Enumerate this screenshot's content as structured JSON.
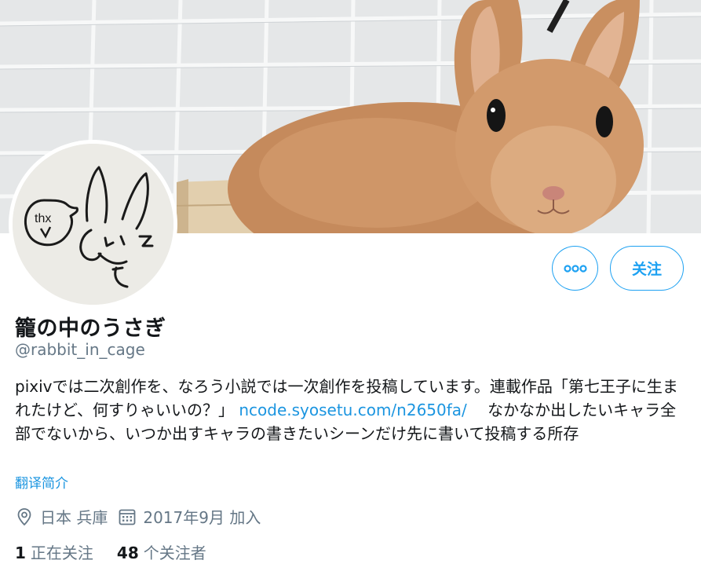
{
  "profile": {
    "name": "籠の中のうさぎ",
    "handle": "@rabbit_in_cage",
    "bio_text_1": "pixivでは二次創作を、なろう小説では一次創作を投稿しています。連載作品「第七王子に生まれたけど、何すりゃいいの？」",
    "bio_link": "ncode.syosetu.com/n2650fa/",
    "bio_text_2": "なかなか出したいキャラ全部でないから、いつか出すキャラの書きたいシーンだけ先に書いて投稿する所存",
    "translate_label": "翻译简介",
    "location": "日本 兵庫",
    "joined": "2017年9月 加入"
  },
  "actions": {
    "follow_label": "关注"
  },
  "stats": {
    "following_count": "1",
    "following_label": "正在关注",
    "followers_count": "48",
    "followers_label": "个关注者"
  },
  "avatar": {
    "doodle_text": "thx"
  },
  "icons": {
    "more": "more-dots-icon",
    "location": "location-pin-icon",
    "calendar": "calendar-icon"
  },
  "colors": {
    "accent": "#1da1f2",
    "link": "#1b95e0",
    "secondary_text": "#657786",
    "primary_text": "#14171a"
  }
}
